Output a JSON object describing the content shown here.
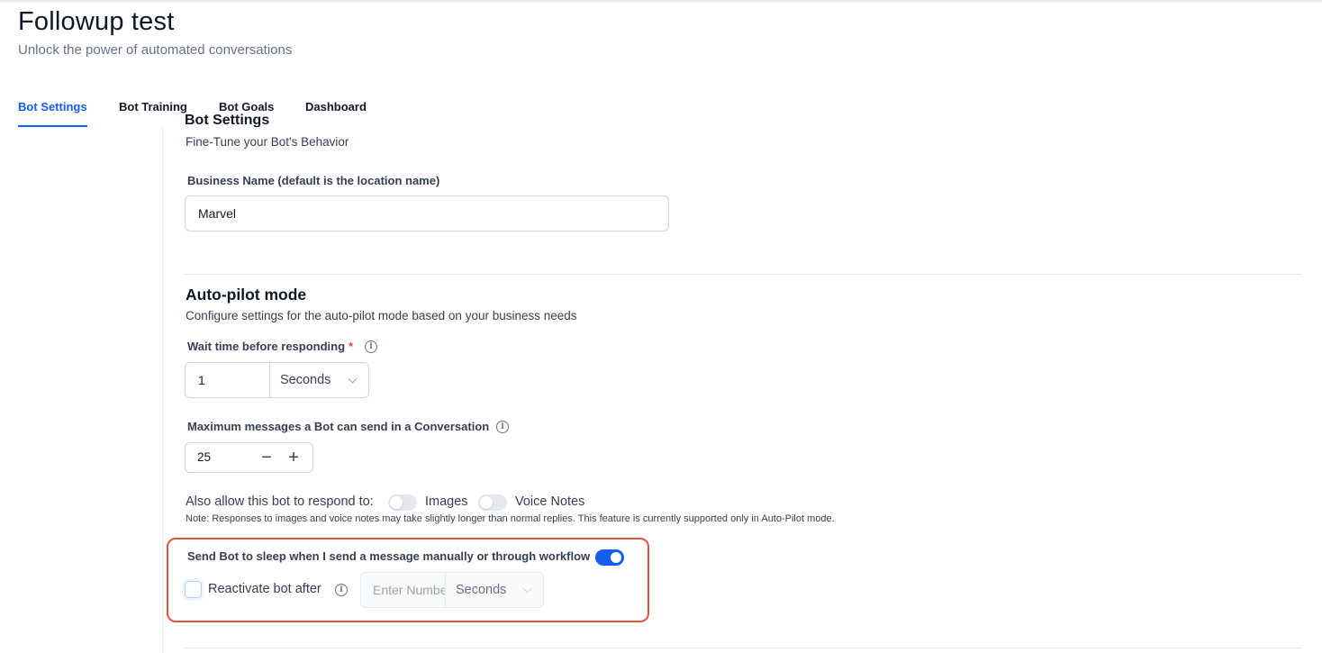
{
  "header": {
    "title": "Followup test",
    "subtitle": "Unlock the power of automated conversations"
  },
  "tabs": [
    {
      "label": "Bot Settings",
      "active": true
    },
    {
      "label": "Bot Training",
      "active": false
    },
    {
      "label": "Bot Goals",
      "active": false
    },
    {
      "label": "Dashboard",
      "active": false
    }
  ],
  "bot_settings": {
    "heading_partial": "Bot Settings",
    "description": "Fine-Tune your Bot's Behavior",
    "business_name": {
      "label": "Business Name (default is the location name)",
      "value": "Marvel"
    }
  },
  "auto_pilot": {
    "title": "Auto-pilot mode",
    "description": "Configure settings for the auto-pilot mode based on your business needs",
    "wait_time": {
      "label": "Wait time before responding",
      "required_mark": "*",
      "value": "1",
      "unit": "Seconds"
    },
    "max_messages": {
      "label": "Maximum messages a Bot can send in a Conversation",
      "value": "25",
      "minus": "−",
      "plus": "+"
    },
    "respond_to": {
      "label": "Also allow this bot to respond to:",
      "images_label": "Images",
      "images_enabled": false,
      "voice_label": "Voice Notes",
      "voice_enabled": false,
      "note": "Note: Responses to images and voice notes may take slightly longer than normal replies. This feature is currently supported only in Auto-Pilot mode."
    },
    "sleep": {
      "label": "Send Bot to sleep when I send a message manually or through workflow",
      "enabled": true,
      "reactivate_label": "Reactivate bot after",
      "reactivate_checked": false,
      "reactivate_placeholder": "Enter Number",
      "reactivate_unit": "Seconds"
    }
  },
  "icons": {
    "info": "info-circle-icon",
    "chevron": "chevron-down-icon"
  },
  "colors": {
    "accent": "#155eef",
    "highlight": "#e5533d",
    "required": "#f04438"
  }
}
